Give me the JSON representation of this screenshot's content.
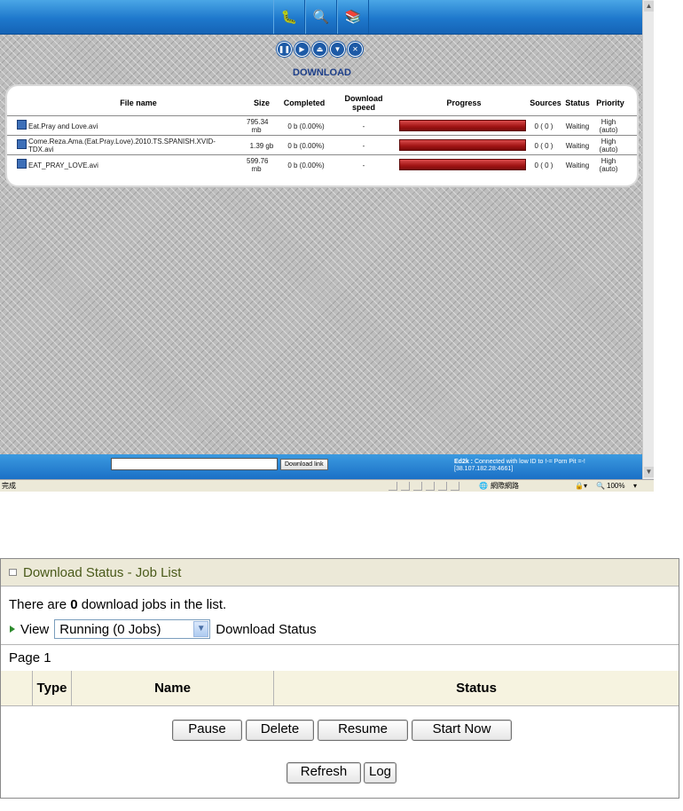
{
  "top": {
    "title": "DOWNLOAD",
    "columns": {
      "file_name": "File name",
      "size": "Size",
      "completed": "Completed",
      "download_speed": "Download speed",
      "progress": "Progress",
      "sources": "Sources",
      "status": "Status",
      "priority": "Priority"
    },
    "files": [
      {
        "name": "Eat.Pray and Love.avi",
        "size": "795.34 mb",
        "completed": "0 b (0.00%)",
        "speed": "-",
        "progress": 0,
        "sources": "0 ( 0 )",
        "status": "Waiting",
        "priority": "High (auto)"
      },
      {
        "name": "Come.Reza.Ama.(Eat.Pray.Love).2010.TS.SPANISH.XVID-TDX.avi",
        "size": "1.39 gb",
        "completed": "0 b (0.00%)",
        "speed": "-",
        "progress": 0,
        "sources": "0 ( 0 )",
        "status": "Waiting",
        "priority": "High (auto)"
      },
      {
        "name": "EAT_PRAY_LOVE.avi",
        "size": "599.76 mb",
        "completed": "0 b (0.00%)",
        "speed": "-",
        "progress": 0,
        "sources": "0 ( 0 )",
        "status": "Waiting",
        "priority": "High (auto)"
      }
    ],
    "download_link_button": "Download link",
    "ed2k_label": "Ed2k :",
    "ed2k_status": "Connected with low ID to !-= Porn Pit =-! [38.107.182.28:4661]",
    "statusbar": {
      "left": "完成",
      "zone": "網際網路",
      "zoom": "100%"
    }
  },
  "bottom": {
    "header_title": "Download Status - Job List",
    "info_prefix": "There are",
    "info_count": "0",
    "info_suffix": "download jobs in the list.",
    "view_label": "View",
    "view_selected": "Running (0 Jobs)",
    "view_suffix": "Download Status",
    "page_label": "Page 1",
    "columns": {
      "type": "Type",
      "name": "Name",
      "status": "Status"
    },
    "buttons": {
      "pause": "Pause",
      "delete": "Delete",
      "resume": "Resume",
      "start_now": "Start Now",
      "refresh": "Refresh",
      "log": "Log"
    }
  },
  "colors": {
    "bar_blue": "#1e78cc",
    "progress_red": "#a11414",
    "header_green": "#4a5a1a"
  }
}
